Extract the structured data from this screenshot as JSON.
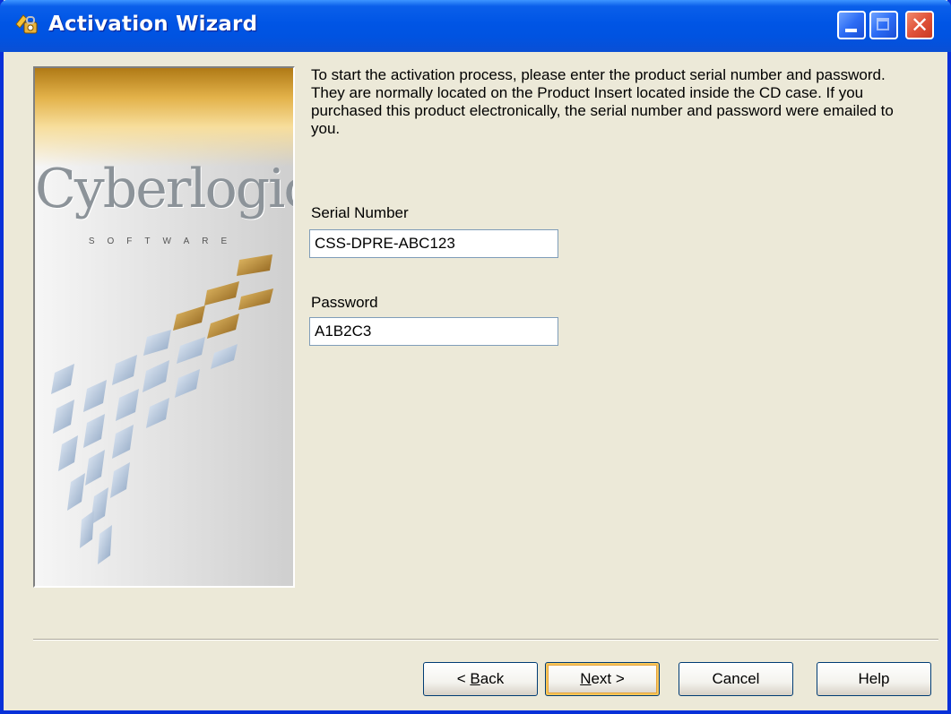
{
  "window": {
    "title": "Activation Wizard",
    "icon": "key-wizard-icon"
  },
  "banner": {
    "logo_text": "Cyberlogic",
    "logo_sub": "SOFTWARE"
  },
  "main": {
    "description": "To start the activation process, please enter the product serial number and password. They are normally located on the Product Insert located inside the CD case. If you purchased this product electronically, the serial number and password were emailed to you.",
    "serial_label": "Serial Number",
    "serial_value": "CSS-DPRE-ABC123",
    "password_label": "Password",
    "password_value": "A1B2C3"
  },
  "buttons": {
    "back_pre": "< ",
    "back_key": "B",
    "back_post": "ack",
    "next_key": "N",
    "next_post": "ext >",
    "cancel": "Cancel",
    "help": "Help"
  },
  "colors": {
    "titlebar": "#0055E5",
    "face": "#ECE9D8",
    "close": "#E0533A"
  }
}
